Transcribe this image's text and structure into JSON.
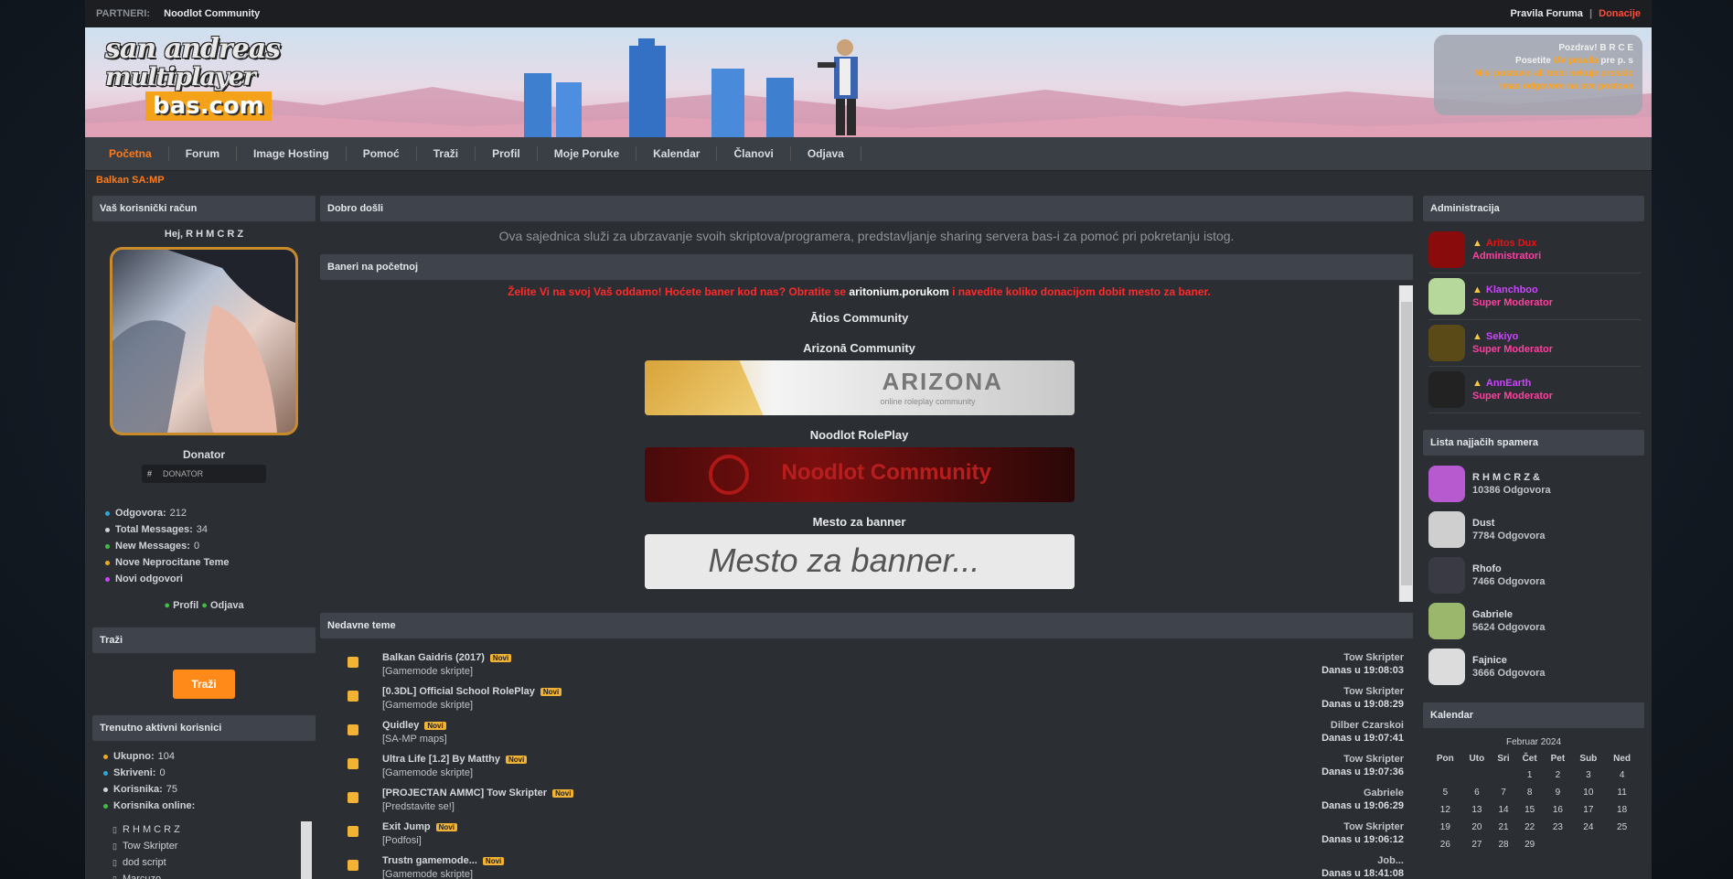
{
  "topbar": {
    "left_label": "PARTNERI:",
    "left_value": "Noodlot Community",
    "right_a": "Pravila Foruma",
    "sep": "|",
    "right_b": "Donacije"
  },
  "header": {
    "logo_line1": "san andreas",
    "logo_line2": "multiplayer",
    "logo_line3": "bas.com",
    "info_line1": "Pozdrav! B R C E",
    "info_line2_prefix": "Posetite",
    "info_line2_link": "UV pravila",
    "info_line2_suffix": "pre p. s",
    "info_line3": "Nisi postavio ali trebi nekuje proskic",
    "info_line4": "Imas odgovore na sve postove"
  },
  "nav": {
    "items": [
      "Početna",
      "Forum",
      "Image Hosting",
      "Pomoć",
      "Traži",
      "Profil",
      "Moje Poruke",
      "Kalendar",
      "Članovi",
      "Odjava"
    ]
  },
  "breadcrumb": "Balkan SA:MP",
  "left": {
    "account_title": "Vaš korisnički račun",
    "greeting": "Hej, R H M C R Z",
    "username": "Donator",
    "rank_a": "#",
    "rank_b": "DONATOR",
    "stats": [
      {
        "label": "Odgovora:",
        "value": "212",
        "color": "#2aa8e0"
      },
      {
        "label": "Total Messages:",
        "value": "34",
        "color": "#cfd3d8"
      },
      {
        "label": "New Messages:",
        "value": "0",
        "color": "#3fbf3f"
      },
      {
        "label": "Nove Neprocitane Teme",
        "value": "",
        "color": "#f2a81b"
      },
      {
        "label": "Novi odgovori",
        "value": "",
        "color": "#cc44ff"
      }
    ],
    "links_a": "Profil",
    "links_b": "Odjava",
    "search_title": "Traži",
    "search_button": "Traži",
    "online_title": "Trenutno aktivni korisnici",
    "online_stats": [
      {
        "label": "Ukupno:",
        "value": "104",
        "color": "#f2a81b"
      },
      {
        "label": "Skriveni:",
        "value": "0",
        "color": "#2aa8e0"
      },
      {
        "label": "Korisnika:",
        "value": "75",
        "color": "#cfd3d8"
      },
      {
        "label": "Korisnika online:",
        "value": "",
        "color": "#3fbf3f"
      }
    ],
    "online_users": [
      "R H M C R Z",
      "Tow Skripter",
      "dod script",
      "Marcuzo"
    ]
  },
  "center": {
    "welcome_title": "Dobro došli",
    "welcome_text": "Ova sajednica služi za ubrzavanje svoih skriptova/programera, predstavljanje sharing servera bas-i za pomoć pri pokretanju istog.",
    "banners_title": "Baneri na početnoj",
    "red_prefix": "Želite Vi na svoj Vaš oddamo! Hoćete baner kod nas? Obratite se",
    "red_link": "aritonium.porukom",
    "red_suffix": "i navedite koliko donacijom dobit mesto za baner.",
    "banner1_title": "Ātios Community",
    "banner2_title": "Arizonā Community",
    "banner2_text": "ARIZONA",
    "banner2_sub": "online roleplay community",
    "banner3_title": "Noodlot RolePlay",
    "banner3_text": "Noodlot Community",
    "banner4_title": "Mesto za banner",
    "banner4_text": "Mesto za banner...",
    "topics_title": "Nedavne teme",
    "topics": [
      {
        "title": "Balkan Gaidris (2017)",
        "sub": "[Gamemode skripte]",
        "author": "Tow Skripter",
        "date": "Danas u 19:08:03"
      },
      {
        "title": "[0.3DL] Official School RolePlay",
        "sub": "[Gamemode skripte]",
        "author": "Tow Skripter",
        "date": "Danas u 19:08:29"
      },
      {
        "title": "Quidley",
        "sub": "[SA-MP maps]",
        "author": "Dilber Czarskoi",
        "date": "Danas u 19:07:41"
      },
      {
        "title": "Ultra Life [1.2] By Matthy",
        "sub": "[Gamemode skripte]",
        "author": "Tow Skripter",
        "date": "Danas u 19:07:36"
      },
      {
        "title": "[PROJECTAN AMMC] Tow Skripter",
        "sub": "[Predstavite se!]",
        "author": "Gabriele",
        "date": "Danas u 19:06:29"
      },
      {
        "title": "Exit Jump",
        "sub": "[Podfosi]",
        "author": "Tow Skripter",
        "date": "Danas u 19:06:12"
      },
      {
        "title": "Trustn gamemode...",
        "sub": "[Gamemode skripte]",
        "author": "Job...",
        "date": "Danas u 18:41:08"
      }
    ],
    "new_badge": "Novi"
  },
  "right": {
    "admin_title": "Administracija",
    "admins": [
      {
        "name": "Aritos Dux",
        "role": "Administratori",
        "avatar": "#8a0b0b"
      },
      {
        "name": "Klanchboo",
        "role": "Super Moderator",
        "avatar": "#b6d89a"
      },
      {
        "name": "Sekiyo",
        "role": "Super Moderator",
        "avatar": "#5a4a18"
      },
      {
        "name": "AnnEarth",
        "role": "Super Moderator",
        "avatar": "#222"
      }
    ],
    "posters_title": "Lista najjačih spamera",
    "posters": [
      {
        "name": "R H M C R Z &",
        "count": "10386 Odgovora",
        "avatar": "#b75ad0"
      },
      {
        "name": "Dust",
        "count": "7784 Odgovora",
        "avatar": "#cfcfcf"
      },
      {
        "name": "Rhofo",
        "count": "7466 Odgovora",
        "avatar": "#3a3a44"
      },
      {
        "name": "Gabriele",
        "count": "5624 Odgovora",
        "avatar": "#9ab76c"
      },
      {
        "name": "Fajnice",
        "count": "3666 Odgovora",
        "avatar": "#dcdcdc"
      }
    ],
    "cal_title": "Kalendar",
    "cal_month": "Februar 2024",
    "cal_head": [
      "Pon",
      "Uto",
      "Sri",
      "Čet",
      "Pet",
      "Sub",
      "Ned"
    ],
    "cal_rows": [
      [
        "",
        "",
        "",
        "1",
        "2",
        "3",
        "4"
      ],
      [
        "5",
        "6",
        "7",
        "8",
        "9",
        "10",
        "11"
      ],
      [
        "12",
        "13",
        "14",
        "15",
        "16",
        "17",
        "18"
      ],
      [
        "19",
        "20",
        "21",
        "22",
        "23",
        "24",
        "25"
      ],
      [
        "26",
        "27",
        "28",
        "29",
        "",
        "",
        ""
      ]
    ]
  }
}
